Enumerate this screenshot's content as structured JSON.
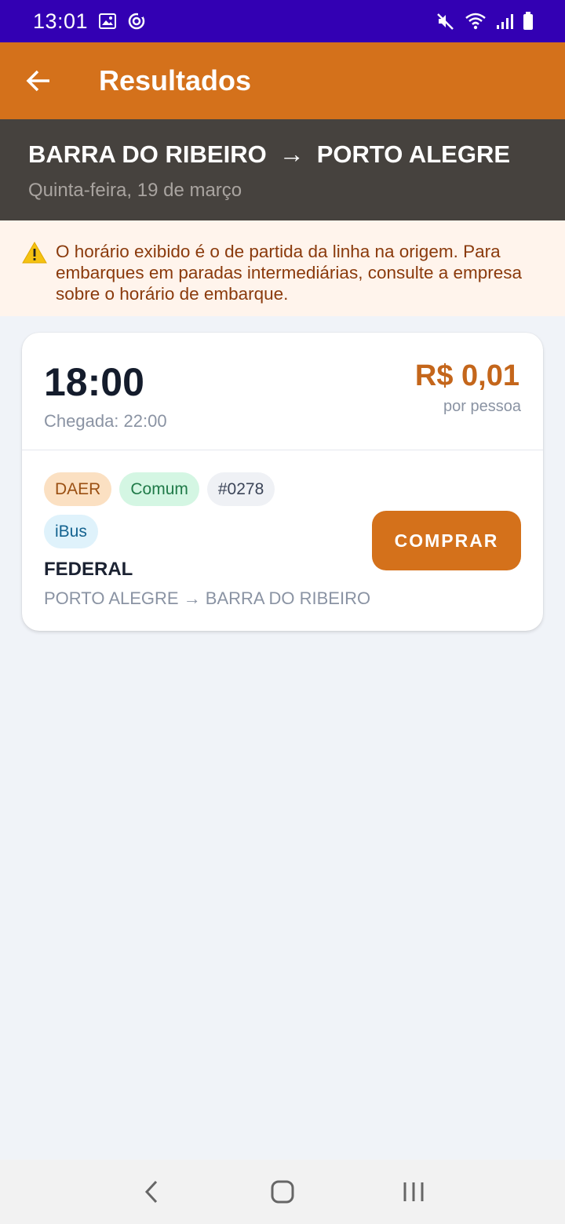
{
  "status_bar": {
    "time": "13:01",
    "left_icons": [
      "image-icon",
      "sync-icon"
    ],
    "right_icons": [
      "mute-icon",
      "wifi-icon",
      "signal-icon",
      "battery-icon"
    ],
    "color": "#3300b3"
  },
  "app_bar": {
    "title": "Resultados",
    "back_icon": "back-arrow-icon",
    "color": "#d4711b"
  },
  "route": {
    "origin": "BARRA DO RIBEIRO",
    "arrow": "→",
    "destination": "PORTO ALEGRE",
    "date": "Quinta-feira, 19 de março"
  },
  "warning": {
    "icon": "warning-icon",
    "text": "O horário exibido é o de partida da linha na origem. Para embarques em paradas intermediárias, consulte a empresa sobre o horário de embarque."
  },
  "results": [
    {
      "departure": "18:00",
      "arrival": "Chegada: 22:00",
      "price": "R$ 0,01",
      "price_unit": "por pessoa",
      "tags": [
        "DAER",
        "Comum",
        "#0278",
        "iBus"
      ],
      "company": "FEDERAL",
      "line_route": "PORTO ALEGRE → BARRA DO RIBEIRO",
      "buy_label": "COMPRAR"
    }
  ],
  "nav_bar": {
    "buttons": [
      "back-nav-icon",
      "home-nav-icon",
      "recents-nav-icon"
    ]
  }
}
